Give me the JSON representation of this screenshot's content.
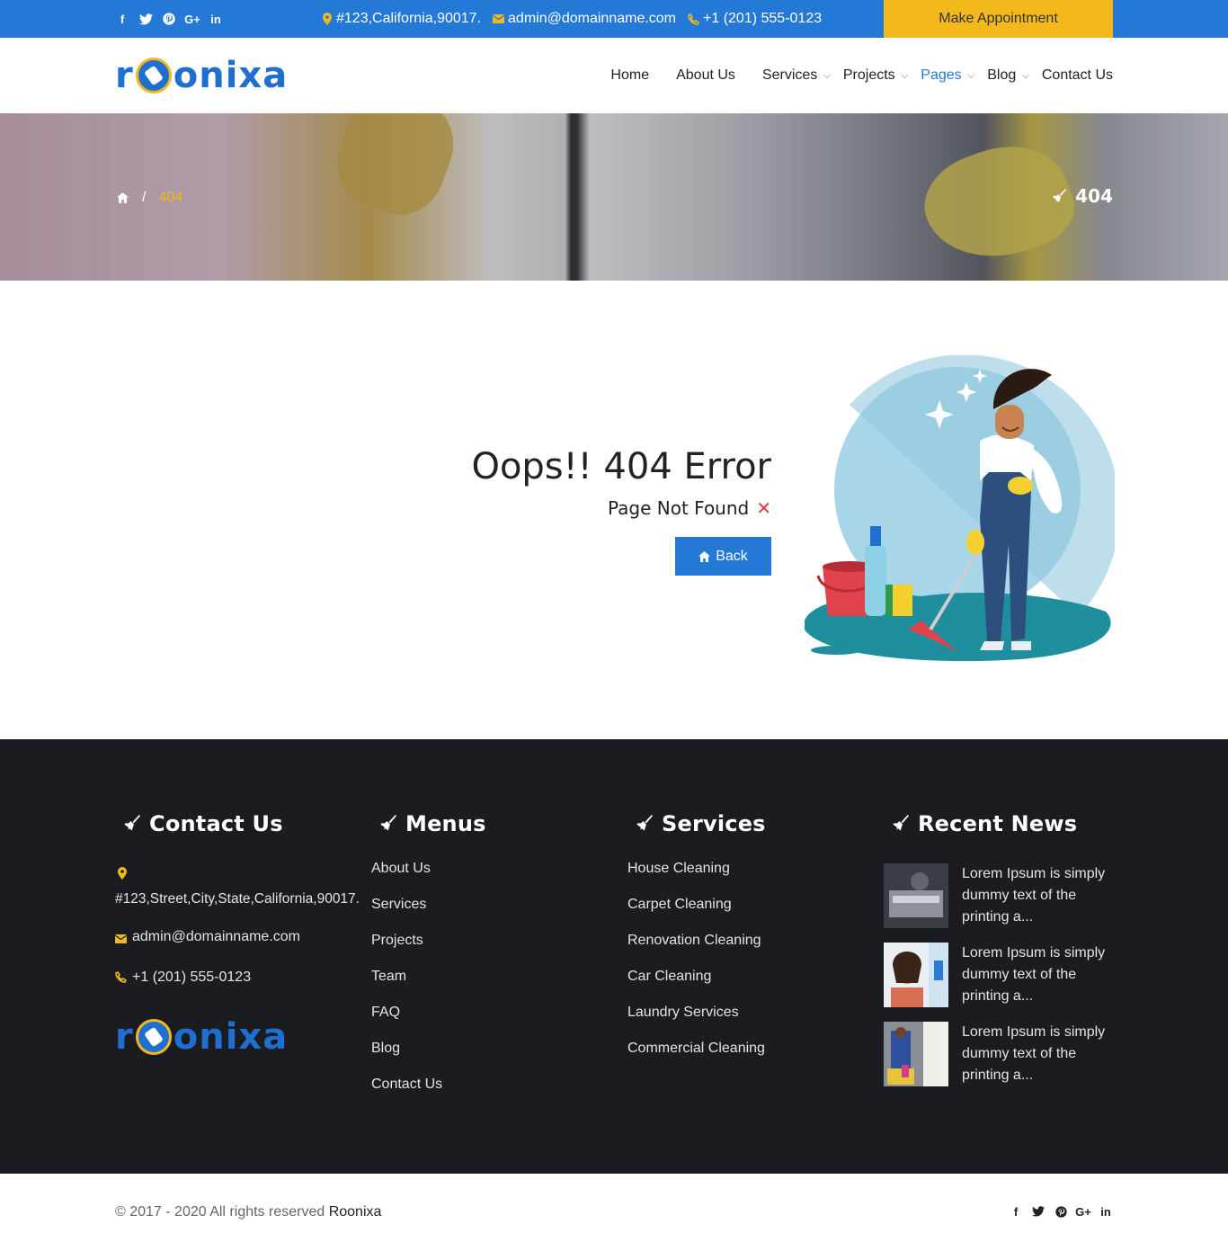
{
  "topbar": {
    "social": [
      {
        "icon": "facebook-icon",
        "glyph": "f"
      },
      {
        "icon": "twitter-icon",
        "glyph": "t"
      },
      {
        "icon": "pinterest-icon",
        "glyph": "p"
      },
      {
        "icon": "google-plus-icon",
        "glyph": "G+"
      },
      {
        "icon": "linkedin-icon",
        "glyph": "in"
      }
    ],
    "address": "#123,California,90017.",
    "email": "admin@domainname.com",
    "phone": "+1 (201) 555-0123",
    "cta": "Make Appointment"
  },
  "brand": {
    "r": "r",
    "rest": "onixa",
    "color": "#1f6fd1",
    "accent": "#f2b81c"
  },
  "nav": {
    "home": "Home",
    "about": "About Us",
    "services": "Services",
    "projects": "Projects",
    "pages": "Pages",
    "blog": "Blog",
    "contact": "Contact Us"
  },
  "banner": {
    "crumb_current": "404",
    "crumb_sep": "/",
    "title": "404"
  },
  "error": {
    "title": "Oops!! 404 Error",
    "subtitle": "Page Not Found",
    "x": "✕",
    "back": "Back"
  },
  "footer": {
    "contact": {
      "heading": "Contact Us",
      "address": "#123,Street,City,State,California,90017.",
      "email": "admin@domainname.com",
      "phone": "+1 (201) 555-0123"
    },
    "menus": {
      "heading": "Menus",
      "items": [
        "About Us",
        "Services",
        "Projects",
        "Team",
        "FAQ",
        "Blog",
        "Contact Us"
      ]
    },
    "services": {
      "heading": "Services",
      "items": [
        "House Cleaning",
        "Carpet Cleaning",
        "Renovation Cleaning",
        "Car Cleaning",
        "Laundry Services",
        "Commercial Cleaning"
      ]
    },
    "news": {
      "heading": "Recent News",
      "items": [
        {
          "text": "Lorem Ipsum is simply dummy text of the printing a..."
        },
        {
          "text": "Lorem Ipsum is simply dummy text of the printing a..."
        },
        {
          "text": "Lorem Ipsum is simply dummy text of the printing a..."
        }
      ]
    }
  },
  "copyright": {
    "text": "© 2017 - 2020 All rights reserved ",
    "brand": "Roonixa"
  },
  "colors": {
    "primary": "#2479d6",
    "accent": "#f2b81c",
    "footer_bg": "#1b1c21",
    "error_x": "#e23a3a"
  }
}
